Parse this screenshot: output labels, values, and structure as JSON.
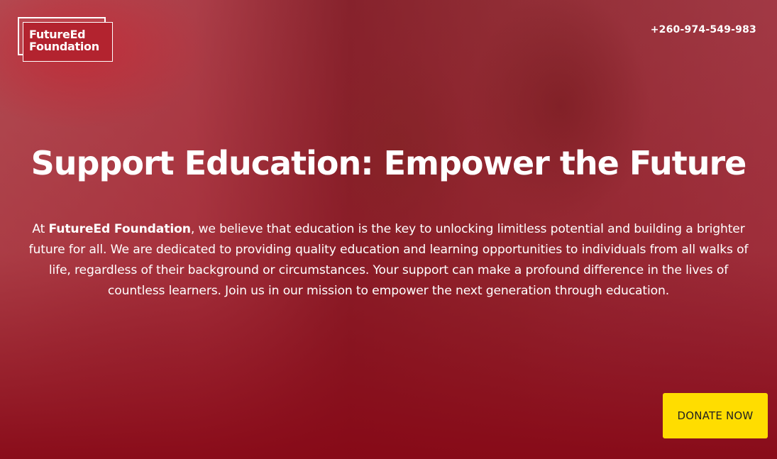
{
  "logo": {
    "line1": "FutureEd",
    "line2": "Foundation"
  },
  "header": {
    "phone": "+260-974-549-983"
  },
  "hero": {
    "title": "Support Education: Empower the Future",
    "description_prefix": "At ",
    "description_org": "FutureEd Foundation",
    "description_body": ", we believe that education is the key to unlocking limitless potential and building a brighter future for all. We are dedicated to providing quality education and learning opportunities to individuals from all walks of life, regardless of their background or circumstances. Your support can make a profound difference in the lives of countless learners. Join us in our mission to empower the next generation through education.",
    "donate_label": "DONATE NOW"
  },
  "colors": {
    "overlay": "#8f0a1c",
    "logo_background": "#b3232f",
    "donate_button": "#ffdd00",
    "text": "#ffffff"
  }
}
